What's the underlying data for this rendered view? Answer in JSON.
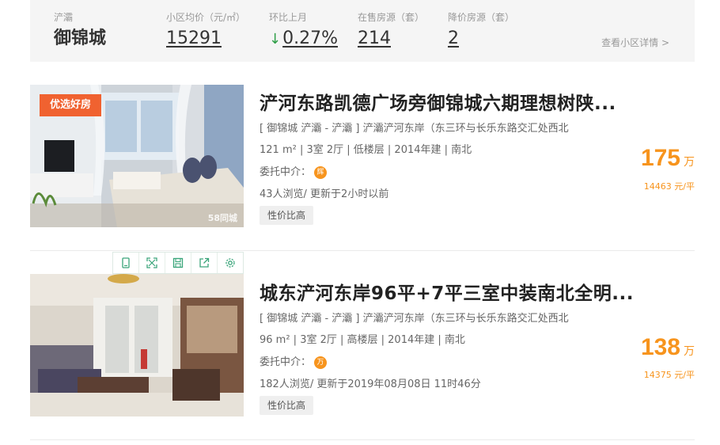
{
  "stats": {
    "district_label": "浐灞",
    "community_name": "御锦城",
    "avg_price_label": "小区均价（元/㎡）",
    "avg_price": "15291",
    "mom_label": "环比上月",
    "mom_value": "0.27%",
    "mom_direction": "down",
    "for_sale_label": "在售房源（套）",
    "for_sale": "214",
    "price_cut_label": "降价房源（套）",
    "price_cut": "2",
    "details_link": "查看小区详情 >"
  },
  "listings": [
    {
      "title": "浐河东路凯德广场旁御锦城六期理想树陕...",
      "address": "[ 御锦城 浐灞 - 浐灞 ] 浐灞浐河东岸（东三环与长乐东路交汇处西北",
      "meta": "121 m² | 3室 2厅 | 低楼层 | 2014年建 | 南北",
      "agent_label": "委托中介：",
      "agent_badge": "辉",
      "views": "43人浏览/ 更新于2小时以前",
      "tag": "性价比高",
      "price": "175",
      "price_unit": "万",
      "unit_price": "14463 元/平",
      "image_badge": "优选好房",
      "image_watermark": "58同城"
    },
    {
      "title": "城东浐河东岸96平+7平三室中装南北全明...",
      "address": "[ 御锦城 浐灞 - 浐灞 ] 浐灞浐河东岸（东三环与长乐东路交汇处西北",
      "meta": "96 m² | 3室 2厅 | 高楼层 | 2014年建 | 南北",
      "agent_label": "委托中介：",
      "agent_badge": "万",
      "views": "182人浏览/ 更新于2019年08月08日 11时46分",
      "tag": "性价比高",
      "price": "138",
      "price_unit": "万",
      "unit_price": "14375 元/平"
    }
  ],
  "colors": {
    "accent_orange": "#f7941d",
    "badge_red": "#f06230",
    "down_green": "#2e9e47",
    "toolbar_icon": "#3aa57a"
  }
}
